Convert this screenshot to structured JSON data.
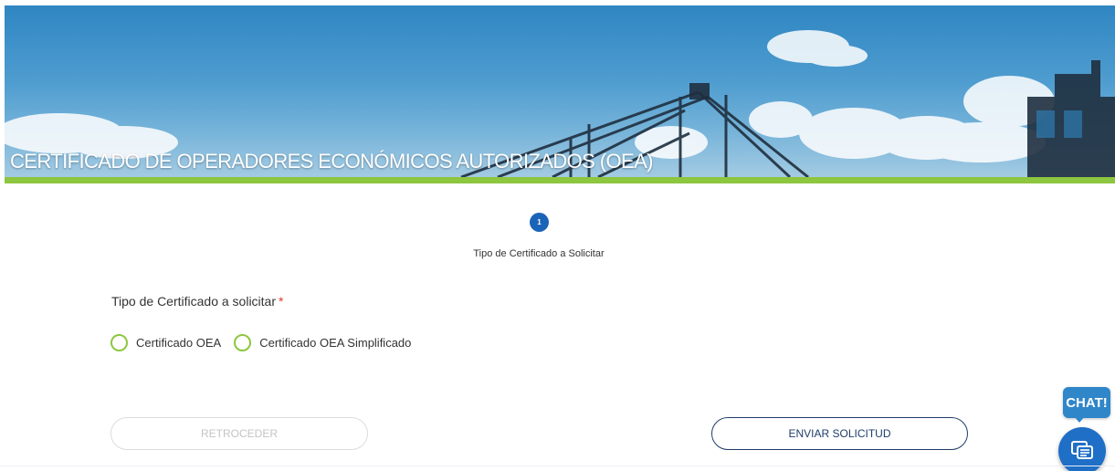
{
  "banner": {
    "title": "CERTIFICADO DE OPERADORES ECONÓMICOS AUTORIZADOS (OEA)"
  },
  "stepper": {
    "steps": [
      {
        "number": "1",
        "label": "Tipo de Certificado a Solicitar",
        "active": true
      }
    ]
  },
  "form": {
    "field_label": "Tipo de Certificado a solicitar",
    "required_mark": "*",
    "options": [
      {
        "label": "Certificado OEA",
        "selected": false
      },
      {
        "label": "Certificado OEA Simplificado",
        "selected": false
      }
    ]
  },
  "buttons": {
    "back_label": "RETROCEDER",
    "send_label": "ENVIAR SOLICITUD"
  },
  "chat": {
    "bubble_label": "CHAT!",
    "icon": "chat-messages-icon"
  },
  "colors": {
    "accent_green": "#8dc63f",
    "primary_blue": "#1a64b8",
    "navy": "#1e3d6b",
    "required_red": "#e53935"
  }
}
